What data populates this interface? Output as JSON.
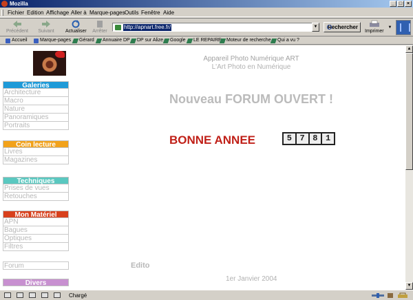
{
  "window": {
    "title": "Mozilla"
  },
  "menu": [
    "Fichier",
    "Edition",
    "Affichage",
    "Aller à",
    "Marque-pages",
    "Outils",
    "Fenêtre",
    "Aide"
  ],
  "nav": {
    "back": "Précédent",
    "forward": "Suivant",
    "reload": "Actualiser",
    "stop": "Arrêter",
    "url": "http://apnart.free.fr/",
    "search": "Rechercher",
    "print": "Imprimer"
  },
  "bookmarks": [
    "Accueil",
    "Marque-pages",
    "Gérard",
    "Annuaire DP",
    "DP sur Alize",
    "Google",
    "LE REPAIRE",
    "Moteur de recherche",
    "Qui a vu ?"
  ],
  "sidebar": [
    {
      "title": "Galeries",
      "color": "#1e9ad8",
      "items": [
        "Architecture",
        "Macro",
        "Nature",
        "Panoramiques",
        "Portraits"
      ]
    },
    {
      "title": "Coin lecture",
      "color": "#f2a21a",
      "items": [
        "Livres",
        "Magazines"
      ]
    },
    {
      "title": "Techniques",
      "color": "#5ac8c0",
      "items": [
        "Prises de vues",
        "Retouches"
      ]
    },
    {
      "title": "Mon Matériel",
      "color": "#d8401c",
      "items": [
        "APN",
        "Bagues",
        "Optiques",
        "Filtres"
      ]
    },
    {
      "title": "",
      "color": "#ffffff",
      "items": [
        "Forum"
      ]
    },
    {
      "title": "Divers",
      "color": "#c890d0",
      "items": []
    }
  ],
  "header": {
    "line1": "Appareil Photo Numérique ART",
    "line2": "L'Art Photo en Numérique"
  },
  "main": {
    "forum": "Nouveau FORUM OUVERT !",
    "greeting": "BONNE ANNEE",
    "counter": [
      "5",
      "7",
      "8",
      "1"
    ],
    "edito": "Edito",
    "date": "1er Janvier 2004"
  },
  "status": {
    "text": "Chargé"
  }
}
